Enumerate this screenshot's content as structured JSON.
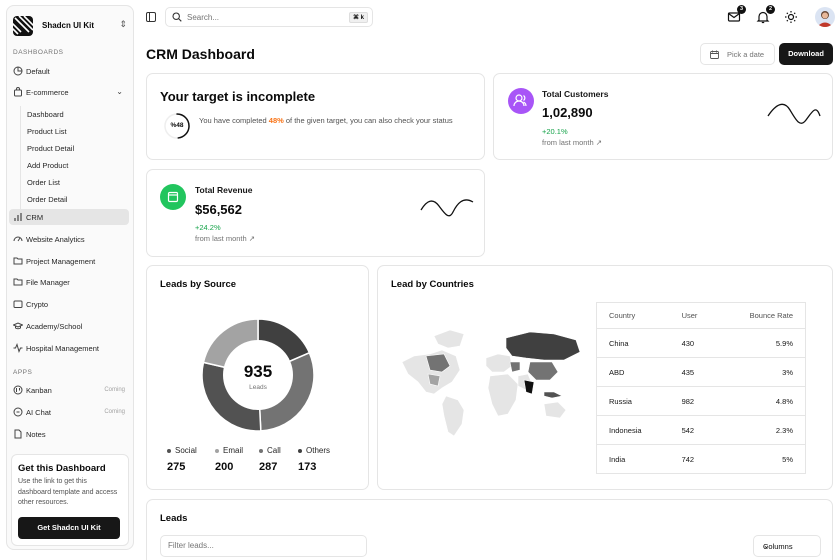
{
  "sidebar": {
    "brand": "Shadcn UI Kit",
    "groups": {
      "dashboards": "DASHBOARDS",
      "apps": "APPS"
    },
    "items": {
      "default": "Default",
      "ecommerce": "E-commerce",
      "crm": "CRM",
      "website_analytics": "Website Analytics",
      "project_management": "Project Management",
      "file_manager": "File Manager",
      "crypto": "Crypto",
      "academy": "Academy/School",
      "hospital": "Hospital Management",
      "kanban": "Kanban",
      "ai_chat": "AI Chat",
      "notes": "Notes"
    },
    "ecommerce_sub": [
      "Dashboard",
      "Product List",
      "Product Detail",
      "Add Product",
      "Order List",
      "Order Detail"
    ],
    "coming_tag": "Coming",
    "promo": {
      "title": "Get this Dashboard",
      "text": "Use the link to get this dashboard template and access other resources.",
      "button": "Get Shadcn UI Kit"
    }
  },
  "topbar": {
    "search_placeholder": "Search...",
    "search_shortcut": "⌘ k",
    "mail_badge": "3",
    "notif_badge": "2"
  },
  "page": {
    "title": "CRM Dashboard",
    "date_button": "Pick a date",
    "download_button": "Download"
  },
  "target": {
    "title": "Your target is incomplete",
    "ring_label": "%48",
    "progress": 0.48,
    "text_before": "You have completed ",
    "percent": "48%",
    "text_after": " of the given target, you can also check your status"
  },
  "customers": {
    "label": "Total Customers",
    "value": "1,02,890",
    "change": "+20.1%",
    "sub": "from last month ↗"
  },
  "revenue": {
    "label": "Total Revenue",
    "value": "$56,562",
    "change": "+24.2%",
    "sub": "from last month ↗"
  },
  "leads_source": {
    "title": "Leads by Source",
    "total": "935",
    "total_label": "Leads",
    "legend": [
      {
        "name": "Social",
        "value": "275",
        "color": "#525252"
      },
      {
        "name": "Email",
        "value": "200",
        "color": "#a3a3a3"
      },
      {
        "name": "Call",
        "value": "287",
        "color": "#737373"
      },
      {
        "name": "Others",
        "value": "173",
        "color": "#404040"
      }
    ]
  },
  "countries": {
    "title": "Lead by Countries",
    "headers": [
      "Country",
      "User",
      "Bounce Rate"
    ],
    "rows": [
      [
        "China",
        "430",
        "5.9%"
      ],
      [
        "ABD",
        "435",
        "3%"
      ],
      [
        "Russia",
        "982",
        "4.8%"
      ],
      [
        "Indonesia",
        "542",
        "2.3%"
      ],
      [
        "India",
        "742",
        "5%"
      ]
    ]
  },
  "leads": {
    "title": "Leads",
    "filter_placeholder": "Filter leads...",
    "columns_button": "Columns"
  }
}
